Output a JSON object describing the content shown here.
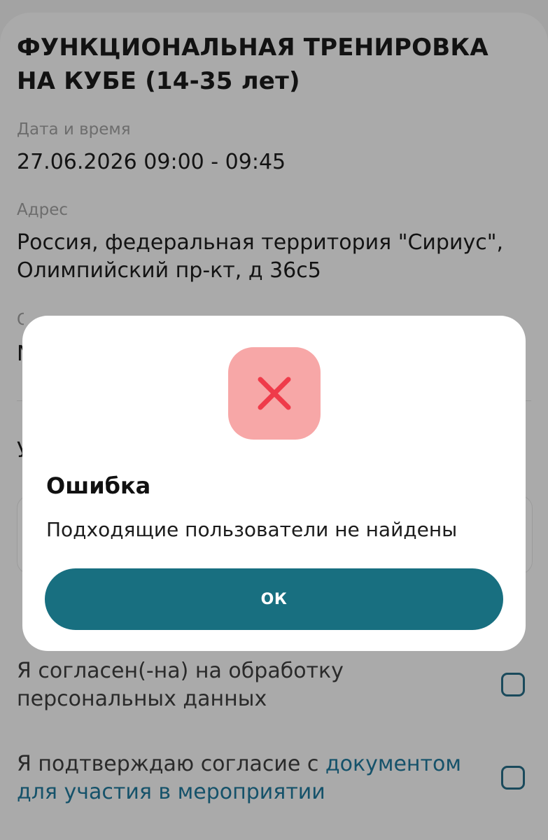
{
  "event": {
    "title": "ФУНКЦИОНАЛЬНАЯ ТРЕНИРОВКА НА КУБЕ (14-35 лет)",
    "datetime_label": "Дата и время",
    "datetime_value": "27.06.2026 09:00 - 09:45",
    "address_label": "Адрес",
    "address_value": "Россия, федеральная территория \"Сириус\", Олимпийский пр-кт, д 36с5",
    "partial_label": "Ор",
    "partial_value": "N",
    "partial_field_label": "У"
  },
  "consents": {
    "personal_data_label": "Я согласен(-на) на обработку персональных данных",
    "document_prefix": "Я подтверждаю согласие с ",
    "document_link": "документом для участия в мероприятии"
  },
  "dialog": {
    "title": "Ошибка",
    "message": "Подходящие пользователи не найдены",
    "button_label": "ОК",
    "icon": "close-icon"
  },
  "colors": {
    "accent": "#186f80",
    "error_icon": "#ef3b4a",
    "error_badge": "#f7a7a7",
    "link": "#15526a"
  }
}
